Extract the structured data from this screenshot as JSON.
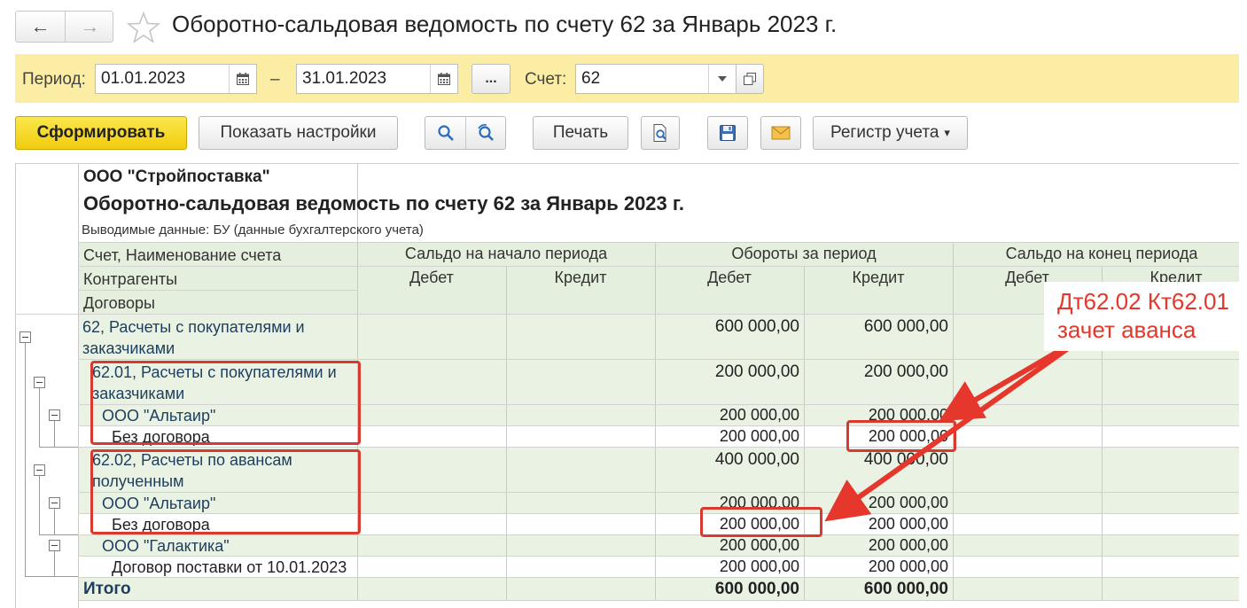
{
  "window": {
    "title": "Оборотно-сальдовая ведомость по счету 62 за Январь 2023 г.",
    "back_icon": "←",
    "forward_icon": "→"
  },
  "filters": {
    "period_label": "Период:",
    "date_from": "01.01.2023",
    "dash": "–",
    "date_to": "31.01.2023",
    "dots_label": "...",
    "account_label": "Счет:",
    "account_value": "62"
  },
  "toolbar": {
    "generate_label": "Сформировать",
    "settings_label": "Показать настройки",
    "print_label": "Печать",
    "register_label": "Регистр учета",
    "register_caret": "▾"
  },
  "report": {
    "company": "ООО \"Стройпоставка\"",
    "title": "Оборотно-сальдовая ведомость по счету 62 за Январь 2023 г.",
    "subtitle": "Выводимые данные: БУ (данные бухгалтерского учета)",
    "header": {
      "left_rows": [
        "Счет, Наименование счета",
        "Контрагенты",
        "Договоры"
      ],
      "groups": [
        "Сальдо на начало периода",
        "Обороты за период",
        "Сальдо на конец периода"
      ],
      "debit": "Дебет",
      "credit": "Кредит"
    },
    "rows": [
      {
        "label": "62, Расчеты с покупателями и заказчиками",
        "debit": "600 000,00",
        "credit": "600 000,00"
      },
      {
        "label": "62.01, Расчеты с покупателями и заказчиками",
        "debit": "200 000,00",
        "credit": "200 000,00"
      },
      {
        "label": "ООО \"Альтаир\"",
        "debit": "200 000,00",
        "credit": "200 000,00"
      },
      {
        "label": "Без договора",
        "debit": "200 000,00",
        "credit": "200 000,00"
      },
      {
        "label": "62.02, Расчеты по авансам полученным",
        "debit": "400 000,00",
        "credit": "400 000,00"
      },
      {
        "label": "ООО \"Альтаир\"",
        "debit": "200 000,00",
        "credit": "200 000,00"
      },
      {
        "label": "Без договора",
        "debit": "200 000,00",
        "credit": "200 000,00"
      },
      {
        "label": "ООО \"Галактика\"",
        "debit": "200 000,00",
        "credit": "200 000,00"
      },
      {
        "label": "Договор поставки от 10.01.2023",
        "debit": "200 000,00",
        "credit": "200 000,00"
      }
    ],
    "total": {
      "label": "Итого",
      "debit": "600 000,00",
      "credit": "600 000,00"
    }
  },
  "annotation": {
    "line1": "Дт62.02 Кт62.01",
    "line2": "зачет аванса",
    "color": "#e5372b"
  }
}
